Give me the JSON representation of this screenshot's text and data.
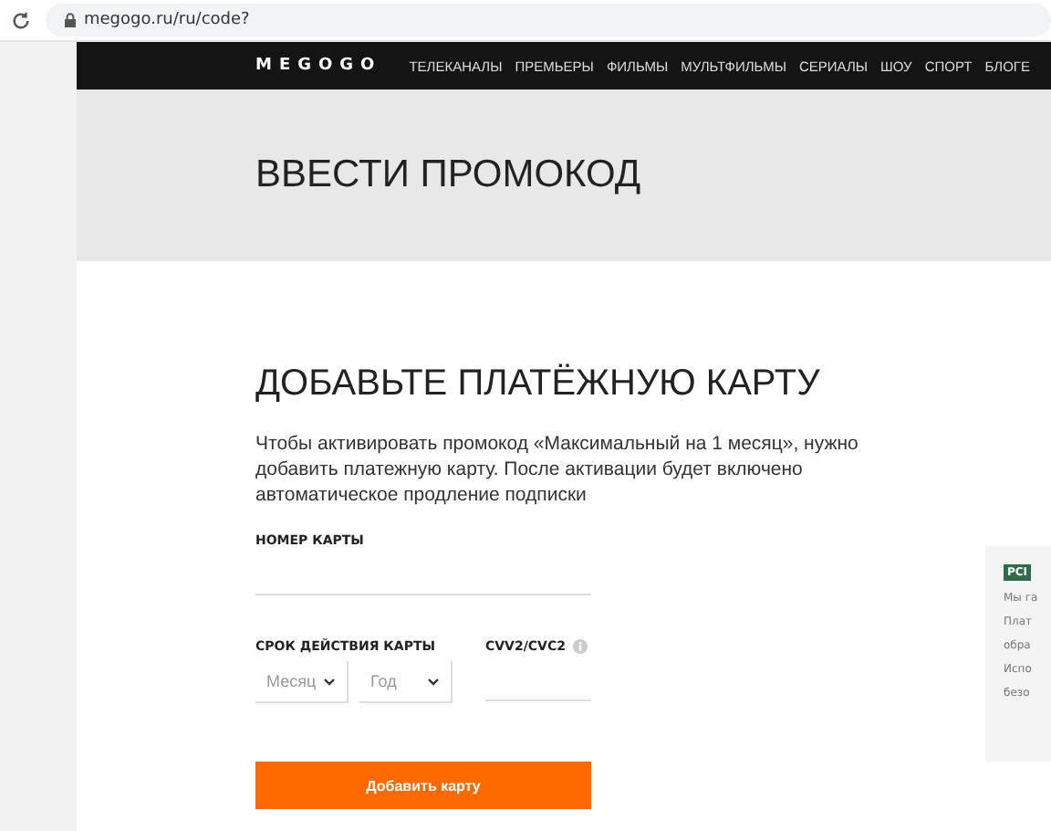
{
  "browser": {
    "url": "megogo.ru/ru/code?"
  },
  "nav": {
    "logo": "MEGOGO",
    "items": [
      "ТЕЛЕКАНАЛЫ",
      "ПРЕМЬЕРЫ",
      "ФИЛЬМЫ",
      "МУЛЬТФИЛЬМЫ",
      "СЕРИАЛЫ",
      "ШОУ",
      "СПОРТ",
      "БЛОГЕ"
    ]
  },
  "header": {
    "title": "ВВЕСТИ ПРОМОКОД"
  },
  "form": {
    "title": "ДОБАВЬТЕ ПЛАТЁЖНУЮ КАРТУ",
    "description": "Чтобы активировать промокод «Максимальный на 1 месяц», нужно\nдобавить платежную карту. После активации будет включено\nавтоматическое продление подписки",
    "card_label": "НОМЕР КАРТЫ",
    "expiry_label": "СРОК ДЕЙСТВИЯ КАРТЫ",
    "month_placeholder": "Месяц",
    "year_placeholder": "Год",
    "cvv_label": "CVV2/CVC2",
    "submit": "Добавить карту"
  },
  "security": {
    "badge": "PCI",
    "lines": [
      "Мы га",
      "Плат",
      "обра",
      "Испо",
      "безо"
    ]
  }
}
